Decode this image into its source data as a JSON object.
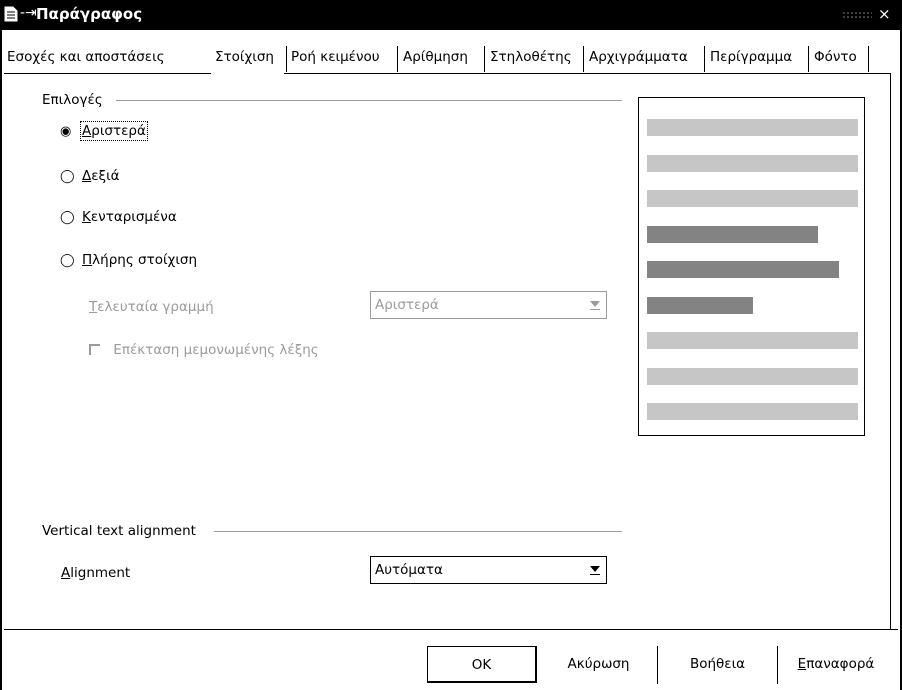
{
  "window": {
    "title": "Παράγραφος",
    "close_glyph": "×"
  },
  "tabs": [
    {
      "label": "Εσοχές και αποστάσεις"
    },
    {
      "label": "Στοίχιση"
    },
    {
      "label": "Ροή κειμένου"
    },
    {
      "label": "Αρίθμηση"
    },
    {
      "label": "Στηλοθέτης"
    },
    {
      "label": "Αρχιγράμματα"
    },
    {
      "label": "Περίγραμμα"
    },
    {
      "label": "Φόντο"
    }
  ],
  "active_tab": "Στοίχιση",
  "options": {
    "heading": "Επιλογές",
    "radios": [
      {
        "label": "Αριστερά",
        "accel": "Α",
        "rest": "ριστερά",
        "checked": true
      },
      {
        "label": "Δεξιά",
        "accel": "Δ",
        "rest": "εξιά",
        "checked": false
      },
      {
        "label": "Κεντραρισμένα",
        "accel": "Κ",
        "rest": "ενταρισμένα",
        "checked": false
      },
      {
        "label": "Πλήρης στοίχιση",
        "accel": "Π",
        "rest": "λήρης στοίχιση",
        "checked": false
      }
    ],
    "last_line": {
      "label": "Τελευταία γραμμή",
      "accel": "Τ",
      "rest": "ελευταία γραμμή",
      "value": "Αριστερά"
    },
    "expand_word": {
      "label": "Επέκταση μεμονωμένης λέξης",
      "checked": false
    }
  },
  "vertical": {
    "heading": "Vertical text alignment",
    "label": "Alignment",
    "accel": "A",
    "rest": "lignment",
    "value": "Αυτόματα"
  },
  "preview": {
    "colors": {
      "light": "#c6c6c6",
      "dark": "#838383"
    },
    "lines": [
      {
        "shade": "light",
        "length": 1.0
      },
      {
        "shade": "light",
        "length": 1.0
      },
      {
        "shade": "light",
        "length": 1.0
      },
      {
        "shade": "dark",
        "length": 0.81
      },
      {
        "shade": "dark",
        "length": 0.91
      },
      {
        "shade": "dark",
        "length": 0.5
      },
      {
        "shade": "light",
        "length": 1.0
      },
      {
        "shade": "light",
        "length": 1.0
      },
      {
        "shade": "light",
        "length": 1.0
      }
    ]
  },
  "buttons": {
    "ok": "OK",
    "cancel": "Ακύρωση",
    "help": "Βοήθεια",
    "reset": "Επαναφορά",
    "reset_accel": "Ε",
    "reset_rest": "παναφορά"
  }
}
